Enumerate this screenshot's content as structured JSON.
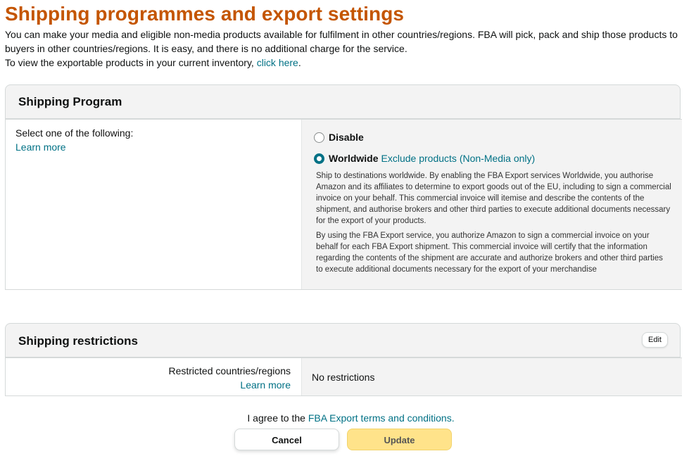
{
  "page": {
    "title": "Shipping programmes and export settings",
    "intro_line1": "You can make your media and eligible non-media products available for fulfilment in other countries/regions. FBA will pick, pack and ship those products to buyers in other countries/regions. It is easy, and there is no additional charge for the service.",
    "intro_line2_prefix": "To view the exportable products in your current inventory,",
    "intro_line2_link": "click here",
    "intro_line2_suffix": "."
  },
  "shipping_program": {
    "header": "Shipping Program",
    "prompt": "Select one of the following:",
    "learn_more": "Learn more",
    "options": [
      {
        "label": "Disable",
        "selected": false
      },
      {
        "label": "Worldwide",
        "selected": true,
        "link": "Exclude products (Non-Media only)"
      }
    ],
    "desc1": "Ship to destinations worldwide. By enabling the FBA Export services Worldwide, you authorise Amazon and its affiliates to determine to export goods out of the EU, including to sign a commercial invoice on your behalf. This commercial invoice will itemise and describe the contents of the shipment, and authorise brokers and other third parties to execute additional documents necessary for the export of your products.",
    "desc2": "By using the FBA Export service, you authorize Amazon to sign a commercial invoice on your behalf for each FBA Export shipment. This commercial invoice will certify that the information regarding the contents of the shipment are accurate and authorize brokers and other third parties to execute additional documents necessary for the export of your merchandise"
  },
  "shipping_restrictions": {
    "header": "Shipping restrictions",
    "edit_label": "Edit",
    "field_label": "Restricted countries/regions",
    "learn_more": "Learn more",
    "value": "No restrictions"
  },
  "footer": {
    "agree_prefix": "I agree to the",
    "agree_link": "FBA Export terms and conditions.",
    "cancel_label": "Cancel",
    "update_label": "Update"
  },
  "colors": {
    "title": "#c45500",
    "link": "#007185",
    "update_button": "#ffe38a"
  }
}
